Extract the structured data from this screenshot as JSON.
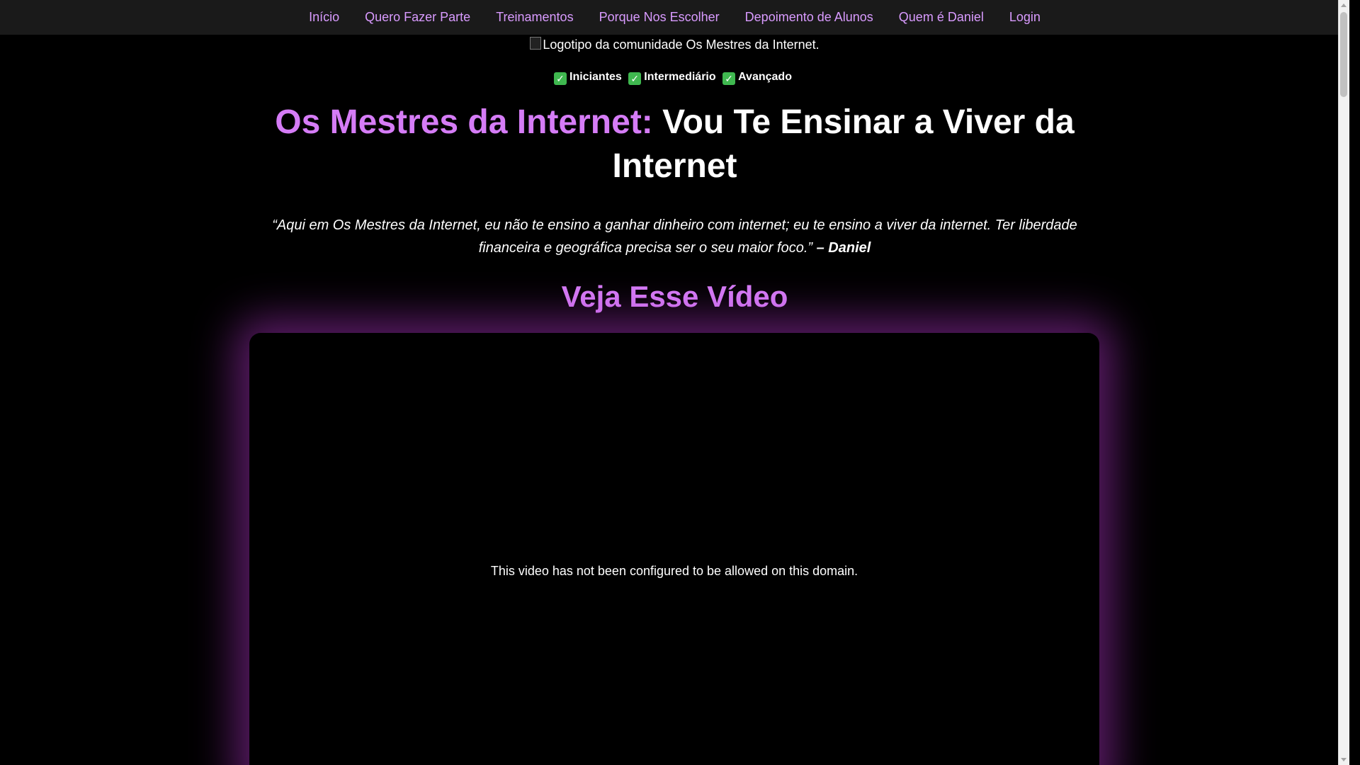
{
  "nav": {
    "items": [
      {
        "label": "Início"
      },
      {
        "label": "Quero Fazer Parte"
      },
      {
        "label": "Treinamentos"
      },
      {
        "label": "Porque Nos Escolher"
      },
      {
        "label": "Depoimento de Alunos"
      },
      {
        "label": "Quem é Daniel"
      },
      {
        "label": "Login"
      }
    ]
  },
  "logo": {
    "alt_text": "Logotipo da comunidade Os Mestres da Internet."
  },
  "levels": {
    "check_icon": "check-mark-icon",
    "items": [
      "Iniciantes",
      "Intermediário",
      "Avançado"
    ]
  },
  "headline": {
    "accent": "Os Mestres da Internet:",
    "rest": "Vou Te Ensinar a Viver da Internet"
  },
  "quote": {
    "text": "“Aqui em Os Mestres da Internet, eu não te ensino a ganhar dinheiro com internet; eu te ensino a viver da internet. Ter liberdade financeira e geográfica precisa ser o seu maior foco.”",
    "author": "– Daniel"
  },
  "video": {
    "title": "Veja Esse Vídeo",
    "message": "This video has not been configured to be allowed on this domain."
  },
  "colors": {
    "accent": "#d57cf6",
    "nav_link": "#d99bff",
    "nav_bg": "#1a1a1a",
    "background": "#000000",
    "glow": "#a832be"
  }
}
